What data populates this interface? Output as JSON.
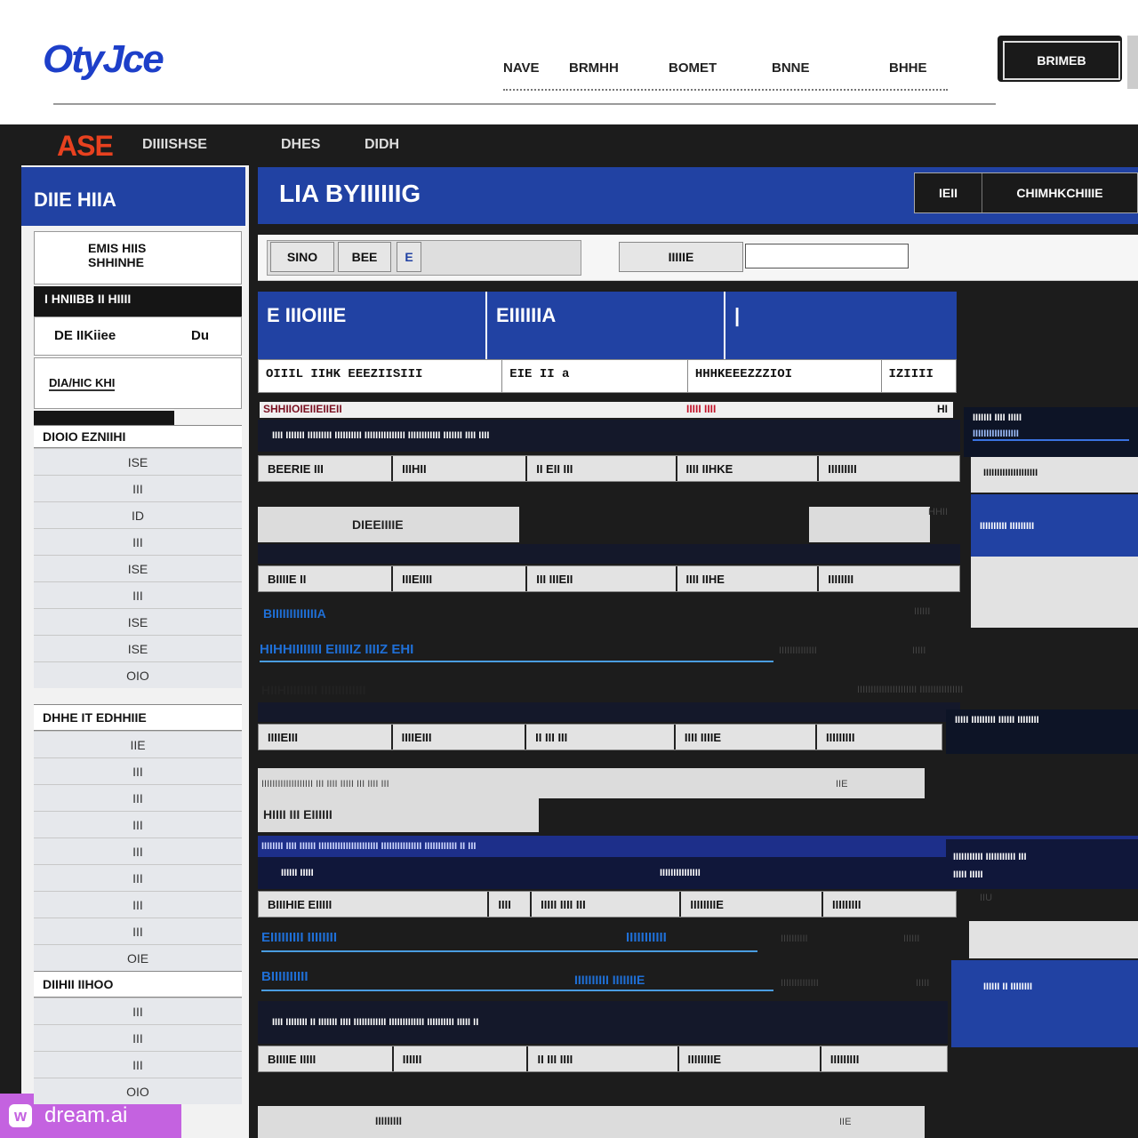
{
  "site": {
    "logo": "OtyJce",
    "logo_tagline": "",
    "nav": [
      "NAVE",
      "BRMHH",
      "BOMET",
      "BNNE",
      "BHHE"
    ],
    "nav_sub": [
      "",
      "",
      "",
      "",
      ""
    ],
    "top_button": "BRIMEB"
  },
  "app": {
    "logo": "ASE",
    "menu": [
      "DIIIISHSE",
      "DHES",
      "DIDH"
    ]
  },
  "sidebar": {
    "title": "DIIE HIIA",
    "box1": [
      "EMIS HIIS",
      "SHHINHE"
    ],
    "box1_dark": "I HNIIBB II HIIII",
    "box1_row": "DE IIKiiee",
    "box1_row_right": "Du",
    "box1_foot": "DIA/HIC KHI",
    "section1": "DIOIO EZNIIHI",
    "section1_rows": [
      "ISE",
      "III",
      "ID",
      "III",
      "ISE",
      "III",
      "ISE",
      "ISE",
      "OIO"
    ],
    "section2": "DHHE IT EDHHIIE",
    "section2_rows": [
      "IIE",
      "III",
      "III",
      "III",
      "III",
      "III",
      "III",
      "III",
      "OIE"
    ],
    "section3": "DIIHII IIHOO",
    "section3_rows": [
      "III",
      "III",
      "III",
      "OIO"
    ]
  },
  "main": {
    "title": "LIA BYIIIIIIG",
    "tabs": [
      "IEII",
      "CHIMHKCHIIIE"
    ],
    "toolbar_buttons": [
      "SINO",
      "BEE",
      "E",
      "IIIIIE"
    ],
    "search_value": "",
    "cards": [
      {
        "label": "",
        "value": "E IIIOIIIE"
      },
      {
        "label": "",
        "value": "EIIIIIIA"
      },
      {
        "label": "",
        "value": "|"
      }
    ],
    "card_row2": [
      "OIIIL IIHK EEEZIISIII",
      "EIE  II  a",
      "HHHKEEEZZZIOI",
      "IZIIII"
    ],
    "section_label": "SHHIIOIEIIEIIEII",
    "section_label_red": "IIIII IIII",
    "section_label_right": "HI",
    "items": [
      {
        "bar": "IIII IIIIIII IIIIIIIII IIIIIIIIII IIIIIIIIIIIIIII IIIIIIIIIIII IIIIIII IIII IIII",
        "cells": [
          "BEERIE III",
          "IIIHII",
          "II EII III",
          "IIII IIHKE",
          "IIIIIIIII"
        ],
        "caption": "DIEEIIIIE",
        "caption_right": "HHII"
      },
      {
        "bar": "",
        "cells": [
          "BIIIIE II",
          "IIIEIIII",
          "III IIIEII",
          "IIII IIHE",
          "IIIIIIII"
        ],
        "link": "BIIIIIIIIIIIIIA",
        "link_right": "IIIIII"
      }
    ],
    "link_row": {
      "text": "HIHHIIIIIIII EIIIIIZ IIIIZ EHI",
      "right": "IIIIIIIIIIIIII",
      "right2": "IIIII"
    },
    "caption_row": {
      "text": "HIIHIIIIIIIII IIIIIIIIIIIII",
      "right": "IIIIIIIIIIIIIIIIIIIIII IIIIIIIIIIIIIIII"
    },
    "item3_cells": [
      "IIIIEIII",
      "IIIIEIII",
      "II III III",
      "IIII IIIIE",
      "IIIIIIIII"
    ],
    "gray_text": "IIIIIIIIIIIIIIIIIII III IIII IIIII III IIII III",
    "gray_right": "IIE",
    "bold_label": "HIIII III EIIIIII",
    "blue_bar": "IIIIIIII IIII IIIIII IIIIIIIIIIIIIIIIIIIIII IIIIIIIIIIIIIII IIIIIIIIIIII II III",
    "blue_bar_sub": "IIIIII IIIII",
    "blue_bar_sub2": "IIIIIIIIIIIIIII",
    "item4_cells": [
      "BIIIHIE EIIIII",
      "IIII",
      "IIIII IIII III",
      "IIIIIIIIE",
      "IIIIIIIII"
    ],
    "link2": {
      "text": "EIIIIIIIII IIIIIIII",
      "mid": "IIIIIIIIIII",
      "right": "IIIIIIIIII",
      "right2": "IIIIII"
    },
    "link3": {
      "text": "BIIIIIIIIII",
      "mid": "IIIIIIIIII IIIIIIIE",
      "right": "IIIIIIIIIIIIII",
      "right2": "IIIII"
    },
    "bar5": "IIII IIIIIIII II IIIIIII IIII IIIIIIIIIIII IIIIIIIIIIIII IIIIIIIIII IIIII II",
    "item5_cells": [
      "BIIIIE IIIII",
      "IIIIII",
      "II III IIII",
      "IIIIIIIIE",
      "IIIIIIIII"
    ],
    "bottom_gray": "IIIIIIIII",
    "bottom_gray_right": "IIE"
  },
  "right": {
    "p1_title": "IIIIIII IIII IIIII",
    "p1_link": "IIIIIIIIIIIIIIIII",
    "p1_sub": "IIIIIIIIIIIIIIIIIIII",
    "p2": "IIIIIIIIII IIIIIIIII",
    "p3": "IIIII IIIIIIIII IIIIII IIIIIIII",
    "p4": "IIIIIIIIIII IIIIIIIIIII III",
    "p4_sub": "IIIII IIIII",
    "p5": "IIIIII II IIIIIIII",
    "p5_small": "IIU"
  },
  "watermark": {
    "icon": "w",
    "text": "dream.ai"
  }
}
